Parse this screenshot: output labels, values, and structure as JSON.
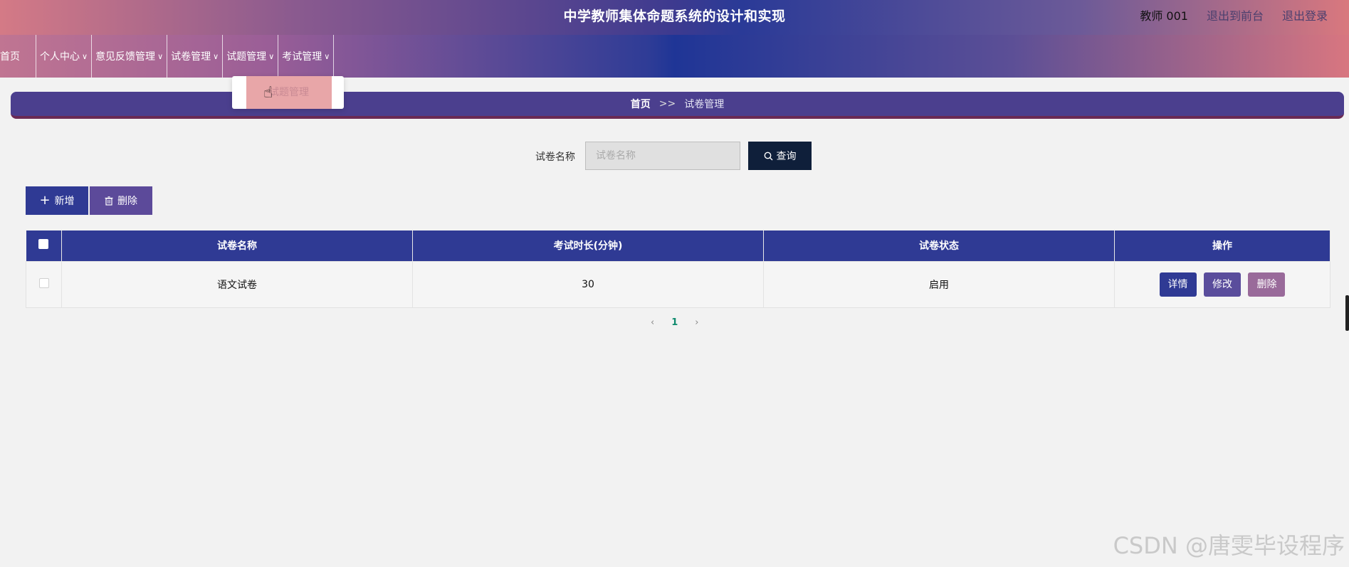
{
  "header": {
    "title": "中学教师集体命题系统的设计和实现",
    "user": "教师 001",
    "links": [
      "退出到前台",
      "退出登录"
    ]
  },
  "nav": {
    "items": [
      {
        "label": "首页",
        "has_dropdown": false
      },
      {
        "label": "个人中心",
        "has_dropdown": true
      },
      {
        "label": "意见反馈管理",
        "has_dropdown": true
      },
      {
        "label": "试卷管理",
        "has_dropdown": true
      },
      {
        "label": "试题管理",
        "has_dropdown": true
      },
      {
        "label": "考试管理",
        "has_dropdown": true
      }
    ],
    "open_dropdown": {
      "parent": "试题管理",
      "items": [
        "试题管理"
      ]
    }
  },
  "breadcrumb": {
    "home": "首页",
    "separator": ">>",
    "current": "试卷管理"
  },
  "search": {
    "label": "试卷名称",
    "placeholder": "试卷名称",
    "value": "",
    "button_label": "查询"
  },
  "actions": {
    "add_label": "新增",
    "delete_label": "删除"
  },
  "table": {
    "columns": [
      "试卷名称",
      "考试时长(分钟)",
      "试卷状态",
      "操作"
    ],
    "rows": [
      {
        "name": "语文试卷",
        "duration": "30",
        "status": "启用",
        "actions": [
          "详情",
          "修改",
          "删除"
        ]
      }
    ]
  },
  "pagination": {
    "current_page": "1",
    "prev": "‹",
    "next": "›"
  },
  "watermark": "CSDN @唐雯毕设程序",
  "colors": {
    "primary": "#2f3a94",
    "secondary": "#5a4d9c",
    "danger": "#996a9a",
    "search_button": "#0f1f3a",
    "page_active": "#0e8a6d"
  }
}
